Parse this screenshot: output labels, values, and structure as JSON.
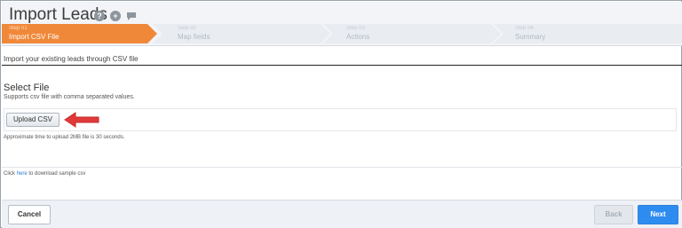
{
  "header": {
    "title": "Import Leads",
    "icons": [
      "help-icon",
      "add-icon",
      "chat-icon"
    ],
    "help_glyph": "?",
    "plus_glyph": "+"
  },
  "steps": [
    {
      "number": "Step 01",
      "name": "Import CSV File",
      "active": true
    },
    {
      "number": "Step 02",
      "name": "Map fields",
      "active": false
    },
    {
      "number": "Step 03",
      "name": "Actions",
      "active": false
    },
    {
      "number": "Step 04",
      "name": "Summary",
      "active": false
    }
  ],
  "intro": "Import your existing leads through CSV file",
  "select_file": {
    "title": "Select File",
    "subtitle": "Supports csv file with comma separated values.",
    "upload_label": "Upload CSV",
    "approx_note": "Approximate time to upload 2MB file is 30 seconds."
  },
  "sample": {
    "prefix": "Click ",
    "link": "here",
    "suffix": " to download sample csv"
  },
  "footer": {
    "cancel": "Cancel",
    "back": "Back",
    "next": "Next"
  },
  "colors": {
    "active_step": "#f0883a",
    "next_button": "#2e8cf0",
    "arrow": "#e03a3a"
  }
}
